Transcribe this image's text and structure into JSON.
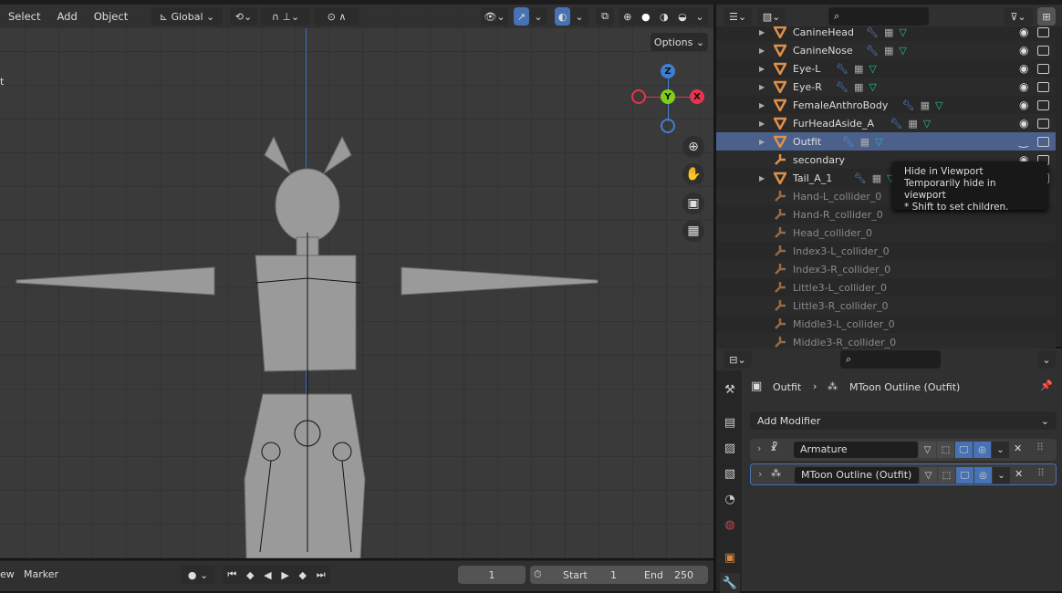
{
  "viewport": {
    "menu": [
      "Select",
      "Add",
      "Object"
    ],
    "orientation": "Global",
    "options_label": "Options",
    "side_label": "t",
    "gizmo": {
      "z": "Z",
      "y": "Y",
      "x": "X"
    },
    "colors": {
      "x": "#e5344f",
      "y": "#7fce1b",
      "z": "#3f7fd0",
      "active": "#4772b3"
    }
  },
  "timeline": {
    "menu": [
      "ew",
      "Marker"
    ],
    "current_frame": "1",
    "start_label": "Start",
    "start": "1",
    "end_label": "End",
    "end": "250"
  },
  "outliner": {
    "rows": [
      {
        "name": "CanineHead",
        "type": "mesh",
        "mods": true,
        "visible": true
      },
      {
        "name": "CanineNose",
        "type": "mesh",
        "mods": true,
        "visible": true
      },
      {
        "name": "Eye-L",
        "type": "mesh",
        "mods": true,
        "visible": true
      },
      {
        "name": "Eye-R",
        "type": "mesh",
        "mods": true,
        "visible": true
      },
      {
        "name": "FemaleAnthroBody",
        "type": "mesh",
        "mods": true,
        "visible": true
      },
      {
        "name": "FurHeadAside_A",
        "type": "mesh",
        "mods": true,
        "visible": true
      },
      {
        "name": "Outfit",
        "type": "mesh",
        "mods": true,
        "visible": false,
        "selected": true
      },
      {
        "name": "secondary",
        "type": "empty",
        "mods": false,
        "visible": true
      },
      {
        "name": "Tail_A_1",
        "type": "mesh",
        "mods": true,
        "visible": true
      },
      {
        "name": "Hand-L_collider_0",
        "type": "empty",
        "dim": true
      },
      {
        "name": "Hand-R_collider_0",
        "type": "empty",
        "dim": true
      },
      {
        "name": "Head_collider_0",
        "type": "empty",
        "dim": true
      },
      {
        "name": "Index3-L_collider_0",
        "type": "empty",
        "dim": true
      },
      {
        "name": "Index3-R_collider_0",
        "type": "empty",
        "dim": true
      },
      {
        "name": "Little3-L_collider_0",
        "type": "empty",
        "dim": true
      },
      {
        "name": "Little3-R_collider_0",
        "type": "empty",
        "dim": true
      },
      {
        "name": "Middle3-L_collider_0",
        "type": "empty",
        "dim": true
      },
      {
        "name": "Middle3-R_collider_0",
        "type": "empty",
        "dim": true
      }
    ],
    "tooltip": {
      "title": "Hide in Viewport",
      "desc": "Temporarily hide in viewport",
      "hint": "* Shift to set children."
    }
  },
  "properties": {
    "breadcrumb": {
      "object": "Outfit",
      "modifier": "MToon Outline (Outfit)"
    },
    "add_modifier": "Add Modifier",
    "modifiers": [
      {
        "name": "Armature",
        "icon": "armature-icon"
      },
      {
        "name": "MToon Outline (Outfit)",
        "icon": "geometry-nodes-icon",
        "active": true
      }
    ]
  }
}
